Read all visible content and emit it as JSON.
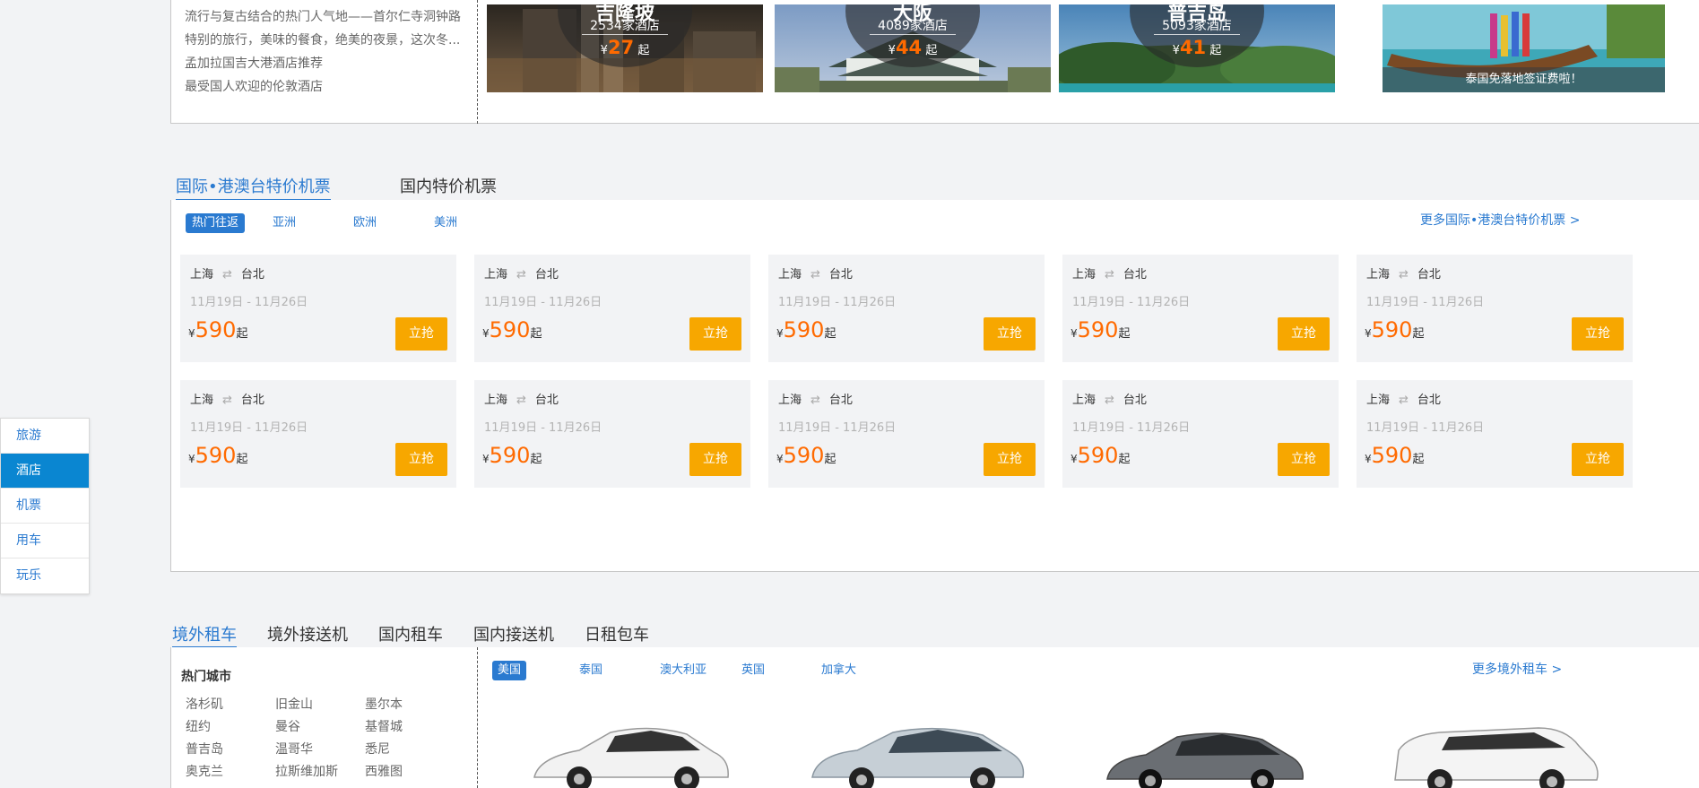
{
  "hotels": {
    "recommendations": [
      "流行与复古结合的热门人气地——首尔仁寺洞钟路",
      "特别的旅行，美味的餐食，绝美的夜景，这次冬...",
      "孟加拉国吉大港酒店推荐",
      "最受国人欢迎的伦敦酒店"
    ],
    "cards": [
      {
        "name": "吉隆坡",
        "count": "2534家酒店",
        "currency": "¥",
        "price": "27",
        "suffix": "起"
      },
      {
        "name": "大阪",
        "count": "4089家酒店",
        "currency": "¥",
        "price": "44",
        "suffix": "起"
      },
      {
        "name": "普吉岛",
        "count": "5093家酒店",
        "currency": "¥",
        "price": "41",
        "suffix": "起"
      }
    ],
    "visa_banner": "泰国免落地签证费啦！"
  },
  "flights": {
    "tabs": [
      "国际•港澳台特价机票",
      "国内特价机票"
    ],
    "regions": [
      "热门往返",
      "亚洲",
      "欧洲",
      "美洲"
    ],
    "more_link": "更多国际•港澳台特价机票 >",
    "deals": [
      {
        "from": "上海",
        "to": "台北",
        "dates": "11月19日 - 11月26日",
        "currency": "¥",
        "price": "590",
        "suffix": "起",
        "button": "立抢"
      },
      {
        "from": "上海",
        "to": "台北",
        "dates": "11月19日 - 11月26日",
        "currency": "¥",
        "price": "590",
        "suffix": "起",
        "button": "立抢"
      },
      {
        "from": "上海",
        "to": "台北",
        "dates": "11月19日 - 11月26日",
        "currency": "¥",
        "price": "590",
        "suffix": "起",
        "button": "立抢"
      },
      {
        "from": "上海",
        "to": "台北",
        "dates": "11月19日 - 11月26日",
        "currency": "¥",
        "price": "590",
        "suffix": "起",
        "button": "立抢"
      },
      {
        "from": "上海",
        "to": "台北",
        "dates": "11月19日 - 11月26日",
        "currency": "¥",
        "price": "590",
        "suffix": "起",
        "button": "立抢"
      },
      {
        "from": "上海",
        "to": "台北",
        "dates": "11月19日 - 11月26日",
        "currency": "¥",
        "price": "590",
        "suffix": "起",
        "button": "立抢"
      },
      {
        "from": "上海",
        "to": "台北",
        "dates": "11月19日 - 11月26日",
        "currency": "¥",
        "price": "590",
        "suffix": "起",
        "button": "立抢"
      },
      {
        "from": "上海",
        "to": "台北",
        "dates": "11月19日 - 11月26日",
        "currency": "¥",
        "price": "590",
        "suffix": "起",
        "button": "立抢"
      },
      {
        "from": "上海",
        "to": "台北",
        "dates": "11月19日 - 11月26日",
        "currency": "¥",
        "price": "590",
        "suffix": "起",
        "button": "立抢"
      },
      {
        "from": "上海",
        "to": "台北",
        "dates": "11月19日 - 11月26日",
        "currency": "¥",
        "price": "590",
        "suffix": "起",
        "button": "立抢"
      }
    ]
  },
  "cars": {
    "tabs": [
      "境外租车",
      "境外接送机",
      "国内租车",
      "国内接送机",
      "日租包车"
    ],
    "hot_cities_title": "热门城市",
    "cities": [
      "洛杉矶",
      "旧金山",
      "墨尔本",
      "纽约",
      "曼谷",
      "基督城",
      "普吉岛",
      "温哥华",
      "悉尼",
      "奥克兰",
      "拉斯维加斯",
      "西雅图"
    ],
    "countries": [
      "美国",
      "泰国",
      "澳大利亚",
      "英国",
      "加拿大"
    ],
    "more_link": "更多境外租车 >"
  },
  "side_nav": {
    "items": [
      "旅游",
      "酒店",
      "机票",
      "用车",
      "玩乐"
    ],
    "active_index": 1
  },
  "colors": {
    "accent": "#2a7ad0",
    "price": "#ff6a00",
    "buy_button": "#f7a700",
    "active_nav": "#0a86d1"
  }
}
